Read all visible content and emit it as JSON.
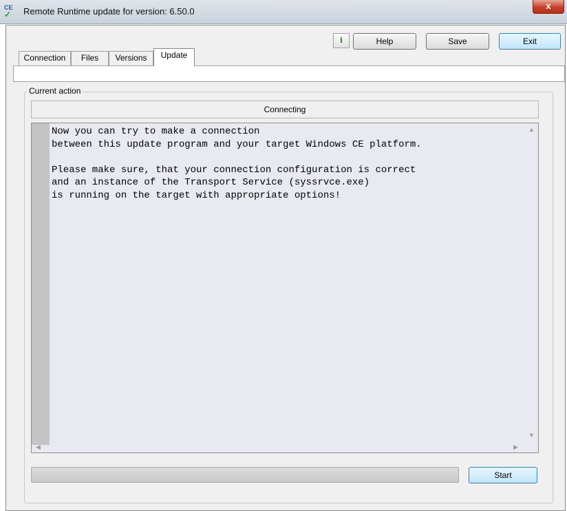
{
  "window": {
    "title": "Remote Runtime update for version: 6.50.0",
    "app_icon": "ce-icon",
    "icon_text": "CE",
    "close_glyph": "x"
  },
  "toolbar": {
    "info_label": "i",
    "help_label": "Help",
    "save_label": "Save",
    "exit_label": "Exit"
  },
  "tabs": [
    {
      "label": "Connection",
      "active": false
    },
    {
      "label": "Files",
      "active": false
    },
    {
      "label": "Versions",
      "active": false
    },
    {
      "label": "Update",
      "active": true
    }
  ],
  "current_action": {
    "group_label": "Current action",
    "status": "Connecting",
    "message": "Now you can try to make a connection\nbetween this update program and your target Windows CE platform.\n\nPlease make sure, that your connection configuration is correct\nand an instance of the Transport Service (syssrvce.exe)\nis running on the target with appropriate options!"
  },
  "progress": {
    "value": 0
  },
  "start_label": "Start",
  "colors": {
    "progress_fill": "#3cb043",
    "text_bg": "#e9e9f1",
    "accent": "#3c7fb1"
  }
}
